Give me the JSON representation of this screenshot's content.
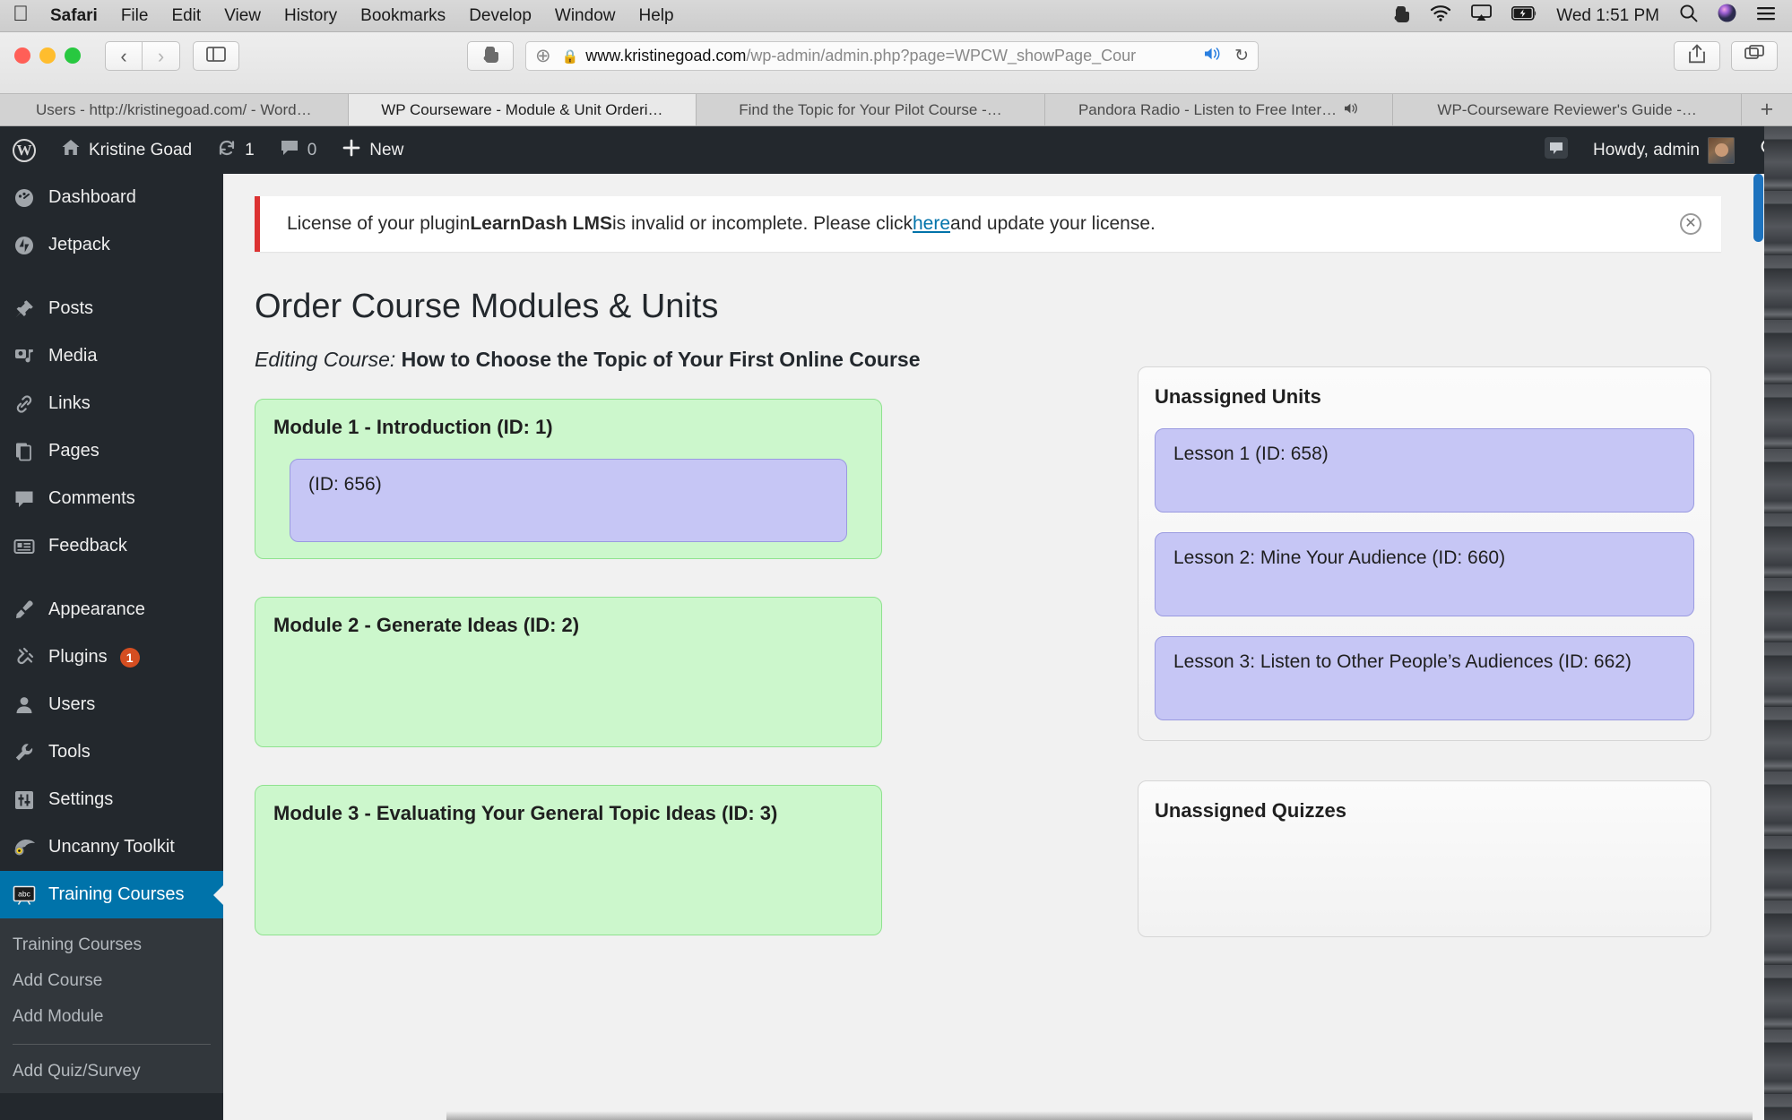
{
  "menubar": {
    "apple_icon": "apple-icon",
    "items": [
      {
        "label": "Safari",
        "bold": true
      },
      {
        "label": "File",
        "bold": false
      },
      {
        "label": "Edit",
        "bold": false
      },
      {
        "label": "View",
        "bold": false
      },
      {
        "label": "History",
        "bold": false
      },
      {
        "label": "Bookmarks",
        "bold": false
      },
      {
        "label": "Develop",
        "bold": false
      },
      {
        "label": "Window",
        "bold": false
      },
      {
        "label": "Help",
        "bold": false
      }
    ],
    "status_icons": [
      "evernote-icon",
      "wifi-icon",
      "airplay-icon",
      "battery-charging-icon"
    ],
    "clock": "Wed 1:51 PM",
    "trailing_icons": [
      "spotlight-search-icon",
      "siri-icon",
      "notification-center-icon"
    ]
  },
  "safari": {
    "back_icon": "chevron-left-icon",
    "forward_icon": "chevron-right-icon",
    "sidebar_icon": "sidebar-icon",
    "extension_icon": "evernote-clipper-icon",
    "url_plus_icon": "add-icon",
    "lock_icon": "lock-icon",
    "url_host": "www.kristinegoad.com",
    "url_path": "/wp-admin/admin.php?page=WPCW_showPage_Cour",
    "audio_icon": "speaker-icon",
    "reload_icon": "reload-icon",
    "share_icon": "share-icon",
    "tabs_overview_icon": "tab-overview-icon",
    "tabs": [
      {
        "label": "Users - http://kristinegoad.com/ - Word…",
        "active": false,
        "audio": false
      },
      {
        "label": "WP Courseware - Module & Unit Orderi…",
        "active": true,
        "audio": false
      },
      {
        "label": "Find the Topic for Your Pilot Course -…",
        "active": false,
        "audio": false
      },
      {
        "label": "Pandora Radio - Listen to Free Inter…",
        "active": false,
        "audio": true
      },
      {
        "label": "WP-Courseware Reviewer's Guide -…",
        "active": false,
        "audio": false
      }
    ],
    "new_tab_label": "+"
  },
  "adminbar": {
    "wp_logo": "W",
    "home_icon": "home-icon",
    "site_name": "Kristine Goad",
    "updates_icon": "updates-icon",
    "updates_count": "1",
    "comments_icon": "comment-icon",
    "comments_count": "0",
    "new_icon": "plus-icon",
    "new_label": "New",
    "feedback_icon": "feedback-icon",
    "howdy": "Howdy, admin",
    "avatar": "avatar",
    "search_icon": "search-icon"
  },
  "sidebar": {
    "items": [
      {
        "label": "Dashboard",
        "icon": "dashboard-icon",
        "current": false,
        "badge": null
      },
      {
        "label": "Jetpack",
        "icon": "jetpack-icon",
        "current": false,
        "badge": null
      },
      {
        "label": "Posts",
        "icon": "pin-icon",
        "current": false,
        "badge": null
      },
      {
        "label": "Media",
        "icon": "media-icon",
        "current": false,
        "badge": null
      },
      {
        "label": "Links",
        "icon": "link-icon",
        "current": false,
        "badge": null
      },
      {
        "label": "Pages",
        "icon": "pages-icon",
        "current": false,
        "badge": null
      },
      {
        "label": "Comments",
        "icon": "comment-icon",
        "current": false,
        "badge": null
      },
      {
        "label": "Feedback",
        "icon": "feedback-icon",
        "current": false,
        "badge": null
      },
      {
        "label": "Appearance",
        "icon": "appearance-icon",
        "current": false,
        "badge": null
      },
      {
        "label": "Plugins",
        "icon": "plugins-icon",
        "current": false,
        "badge": "1"
      },
      {
        "label": "Users",
        "icon": "users-icon",
        "current": false,
        "badge": null
      },
      {
        "label": "Tools",
        "icon": "tools-icon",
        "current": false,
        "badge": null
      },
      {
        "label": "Settings",
        "icon": "settings-icon",
        "current": false,
        "badge": null
      },
      {
        "label": "Uncanny Toolkit",
        "icon": "uncanny-owl-icon",
        "current": false,
        "badge": null
      },
      {
        "label": "Training Courses",
        "icon": "training-courses-icon",
        "current": true,
        "badge": null
      }
    ],
    "submenu": [
      {
        "label": "Training Courses",
        "divider_after": false
      },
      {
        "label": "Add Course",
        "divider_after": false
      },
      {
        "label": "Add Module",
        "divider_after": true
      },
      {
        "label": "Add Quiz/Survey",
        "divider_after": false
      }
    ]
  },
  "notice": {
    "prefix": "License of your plugin ",
    "plugin": "LearnDash LMS",
    "middle": " is invalid or incomplete. Please click ",
    "link": "here",
    "suffix": " and update your license.",
    "dismiss_icon": "close-icon"
  },
  "main": {
    "page_title": "Order Course Modules & Units",
    "editing_label": "Editing Course:",
    "course_name": "How to Choose the Topic of Your First Online Course",
    "modules": [
      {
        "title": "Module 1 - Introduction (ID: 1)",
        "units": [
          {
            "label": "(ID: 656)"
          }
        ]
      },
      {
        "title": "Module 2 - Generate Ideas (ID: 2)",
        "units": []
      },
      {
        "title": "Module 3 - Evaluating Your General Topic Ideas (ID: 3)",
        "units": []
      }
    ],
    "unassigned_units": {
      "title": "Unassigned Units",
      "items": [
        {
          "label": "Lesson 1 (ID: 658)"
        },
        {
          "label": "Lesson 2: Mine Your Audience (ID: 660)"
        },
        {
          "label": "Lesson 3: Listen to Other People’s Audiences (ID: 662)"
        }
      ]
    },
    "unassigned_quizzes": {
      "title": "Unassigned Quizzes",
      "items": []
    }
  },
  "colors": {
    "wp_dark": "#23282d",
    "wp_current_blue": "#0073aa",
    "module_green": "#ccf7cc",
    "unit_purple": "#c6c6f5",
    "notice_red": "#dc3232",
    "badge_orange": "#d54e21",
    "scrollbar_blue": "#1e73be"
  }
}
